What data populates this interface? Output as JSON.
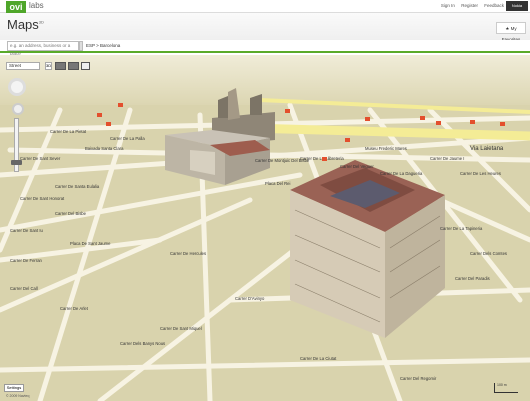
{
  "topbar": {
    "logo": "ovi",
    "labs": "labs",
    "links": [
      "Sign In",
      "Register",
      "Feedback"
    ],
    "button": "Nokia"
  },
  "header": {
    "title": "Maps",
    "title_sup": "3D",
    "favorites": "My Favorites"
  },
  "search": {
    "placeholder": "e.g. an address, business or a place",
    "location": "ESP > Barcelona"
  },
  "map_controls": {
    "mode": "Street",
    "mode_extra": "3D",
    "settings": "Settings",
    "copyright": "© 2009 Navteq",
    "scale": "100 m"
  },
  "streets": [
    "Carrer De La Pietat",
    "Carrer De Sant Sever",
    "Baixada Santa Clara",
    "Carrer De Sant Honorat",
    "Carrer De Santa Eulalia",
    "Carrer Del Bisbe",
    "Carrer De Sant Iu",
    "Carrer De Ferran",
    "Placa De Sant Jaume",
    "Carrer Del Call",
    "Via Laietana",
    "Carrer De La Llibreteria",
    "Carrer Del Veguer",
    "Carrer De La Dagueria",
    "Carrer De Jaume I",
    "Museu Frederic Mares",
    "Carrer De Les Heures",
    "Placa Del Rei",
    "Carrer De La Tapineria",
    "Carrer Dels Comtes",
    "Carrer Del Paradis",
    "Carrer De La Ciutat",
    "Carrer De Sant Miquel",
    "Carrer D'Avinyo",
    "Carrer Dels Banys Nous",
    "Carrer De La Palla",
    "Carrer De Montjuic Del Bisbe",
    "Carrer Del Regomir",
    "Carrer De Hercules",
    "Carrer De Arlet"
  ]
}
